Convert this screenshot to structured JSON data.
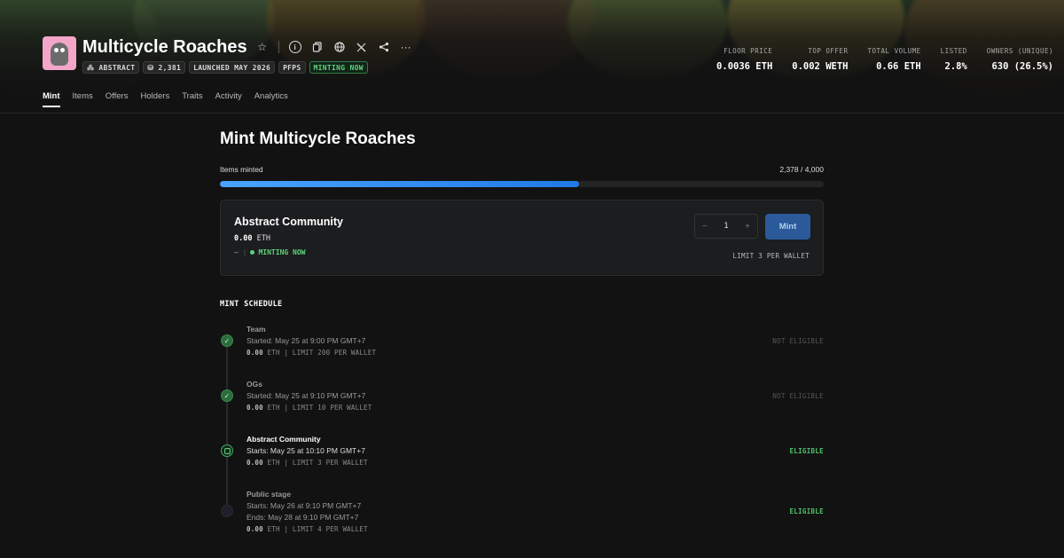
{
  "collection": {
    "title": "Multicycle Roaches",
    "badges": [
      "ABSTRACT",
      "2,381",
      "LAUNCHED MAY 2026",
      "PFPS",
      "MINTING NOW"
    ]
  },
  "stats": [
    {
      "label": "FLOOR PRICE",
      "value": "0.0036 ETH"
    },
    {
      "label": "TOP OFFER",
      "value": "0.002 WETH"
    },
    {
      "label": "TOTAL VOLUME",
      "value": "0.66 ETH"
    },
    {
      "label": "LISTED",
      "value": "2.8%"
    },
    {
      "label": "OWNERS (UNIQUE)",
      "value": "630 (26.5%)"
    }
  ],
  "tabs": [
    "Mint",
    "Items",
    "Offers",
    "Holders",
    "Traits",
    "Activity",
    "Analytics"
  ],
  "mint": {
    "title": "Mint Multicycle Roaches",
    "progress_label": "Items minted",
    "progress_text": "2,378 / 4,000",
    "progress_fraction": 0.5945
  },
  "card": {
    "title": "Abstract Community",
    "price": "0.00",
    "currency": "ETH",
    "dash": "–",
    "status": "MINTING NOW",
    "quantity": "1",
    "minus": "−",
    "plus": "+",
    "mint_label": "Mint",
    "limit": "LIMIT 3 PER WALLET"
  },
  "schedule": {
    "title": "MINT SCHEDULE",
    "stages": [
      {
        "name": "Team",
        "time": "Started: May 25 at 9:00 PM GMT+7",
        "price": "0.00",
        "meta": "ETH | LIMIT 200 PER WALLET",
        "status": "NOT ELIGIBLE"
      },
      {
        "name": "OGs",
        "time": "Started: May 25 at 9:10 PM GMT+7",
        "price": "0.00",
        "meta": "ETH | LIMIT 10 PER WALLET",
        "status": "NOT ELIGIBLE"
      },
      {
        "name": "Abstract Community",
        "time": "Starts: May 25 at 10:10 PM GMT+7",
        "price": "0.00",
        "meta": "ETH | LIMIT 3 PER WALLET",
        "status": "ELIGIBLE"
      },
      {
        "name": "Public stage",
        "time": "Starts: May 26 at 9:10 PM GMT+7",
        "time2": "Ends: May 28 at 9:10 PM GMT+7",
        "price": "0.00",
        "meta": "ETH | LIMIT 4 PER WALLET",
        "status": "ELIGIBLE"
      }
    ]
  },
  "icons": {
    "star": "star-icon",
    "info": "info-icon",
    "copy": "copy-icon",
    "globe": "globe-icon",
    "x": "x-logo-icon",
    "share": "share-icon",
    "more": "more-icon",
    "check": "check-icon"
  },
  "colors": {
    "accent": "#1f7ae6",
    "green": "#5fd27a",
    "mint_button": "#2a5a9a"
  }
}
